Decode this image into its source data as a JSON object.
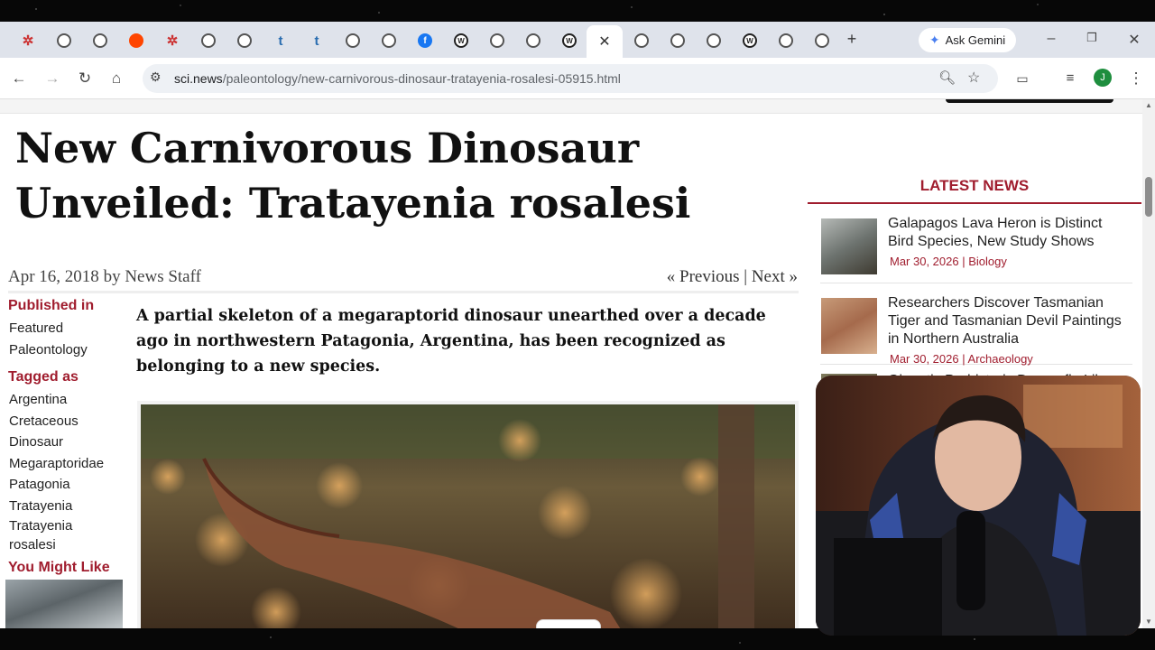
{
  "browser": {
    "tabs": [
      {
        "icon": "asterisk-icon",
        "glyph": "✲"
      },
      {
        "icon": "globe-icon"
      },
      {
        "icon": "globe-icon"
      },
      {
        "icon": "reddit-icon",
        "glyph": "●"
      },
      {
        "icon": "asterisk-icon",
        "glyph": "✲"
      },
      {
        "icon": "globe-icon"
      },
      {
        "icon": "globe-icon"
      },
      {
        "icon": "tumblr-icon",
        "glyph": "t"
      },
      {
        "icon": "tumblr-icon",
        "glyph": "t"
      },
      {
        "icon": "globe-icon"
      },
      {
        "icon": "globe-icon"
      },
      {
        "icon": "facebook-icon",
        "glyph": "f"
      },
      {
        "icon": "wiki-icon",
        "glyph": "W"
      },
      {
        "icon": "globe-icon"
      },
      {
        "icon": "globe-icon"
      },
      {
        "icon": "wiki-icon",
        "glyph": "W"
      },
      {
        "icon": "close-icon",
        "glyph": "✕",
        "active": true
      },
      {
        "icon": "globe-icon"
      },
      {
        "icon": "globe-icon"
      },
      {
        "icon": "globe-icon"
      },
      {
        "icon": "wiki-icon",
        "glyph": "W"
      },
      {
        "icon": "globe-icon"
      },
      {
        "icon": "globe-icon"
      }
    ],
    "new_tab": "+",
    "gemini_label": "Ask Gemini",
    "url_host": "sci.news",
    "url_path": "/paleontology/new-carnivorous-dinosaur-tratayenia-rosalesi-05915.html",
    "avatar_letter": "J"
  },
  "article": {
    "title": "New Carnivorous Dinosaur Unveiled: Tratayenia rosalesi",
    "date": "Apr 16, 2018",
    "by": "by",
    "author": "News Staff",
    "prev": "« Previous",
    "sep": "|",
    "next": "Next »",
    "lede": "A partial skeleton of a megaraptorid dinosaur unearthed over a decade ago in northwestern Patagonia, Argentina, has been recognized as belonging to a new species."
  },
  "sidebar": {
    "published_heading": "Published in",
    "published": [
      "Featured",
      "Paleontology"
    ],
    "tagged_heading": "Tagged as",
    "tags": [
      "Argentina",
      "Cretaceous",
      "Dinosaur",
      "Megaraptoridae",
      "Patagonia",
      "Tratayenia",
      "Tratayenia rosalesi"
    ],
    "might_like_heading": "You Might Like"
  },
  "latest": {
    "heading": "LATEST NEWS",
    "items": [
      {
        "title": "Galapagos Lava Heron is Distinct Bird Species, New Study Shows",
        "date": "Mar 30, 2026",
        "sep": "|",
        "category": "Biology"
      },
      {
        "title": "Researchers Discover Tasmanian Tiger and Tasmanian Devil Paintings in Northern Australia",
        "date": "Mar 30, 2026",
        "sep": "|",
        "category": "Archaeology"
      },
      {
        "title": "Gigantic Prehistoric Dragonfly-Like"
      }
    ]
  },
  "colors": {
    "accent": "#a01d2e",
    "tab_bg": "#dfe3eb"
  }
}
